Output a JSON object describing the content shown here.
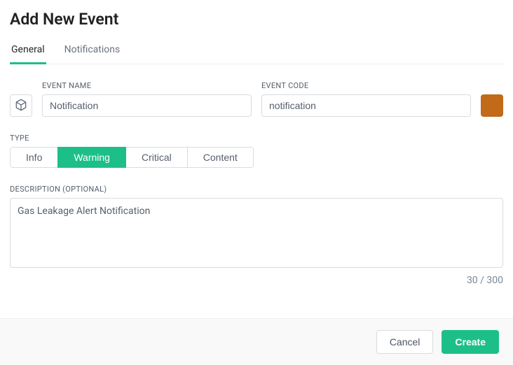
{
  "title": "Add New Event",
  "tabs": {
    "general": "General",
    "notifications": "Notifications",
    "active": "General"
  },
  "fields": {
    "event_name": {
      "label": "EVENT NAME",
      "value": "Notification"
    },
    "event_code": {
      "label": "EVENT CODE",
      "value": "notification"
    },
    "color": {
      "hex": "#c06a1a"
    }
  },
  "type": {
    "label": "TYPE",
    "options": {
      "info": "Info",
      "warning": "Warning",
      "critical": "Critical",
      "content": "Content"
    },
    "selected": "warning"
  },
  "description": {
    "label": "DESCRIPTION (OPTIONAL)",
    "value": "Gas Leakage Alert Notification",
    "counter": "30 / 300"
  },
  "actions": {
    "cancel": "Cancel",
    "create": "Create"
  }
}
